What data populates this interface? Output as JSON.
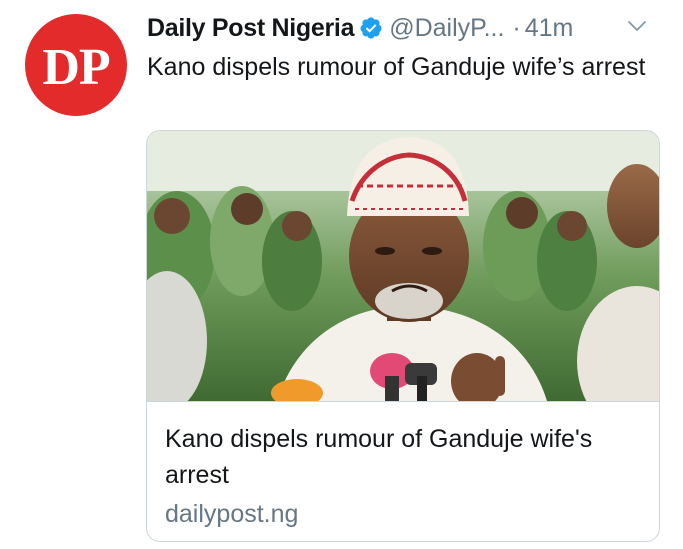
{
  "tweet": {
    "author": {
      "avatar_text": "DP",
      "display_name": "Daily Post Nigeria",
      "handle": "@DailyP...",
      "verified_icon": "verified-badge-icon"
    },
    "separator": "·",
    "time": "41m",
    "menu_icon": "chevron-down-icon",
    "text": "Kano dispels rumour of Ganduje wife’s arrest",
    "card": {
      "title": "Kano dispels rumour of Ganduje wife's arrest",
      "domain": "dailypost.ng"
    }
  },
  "colors": {
    "avatar_red": "#e32b2b",
    "verified_blue": "#1da1f2",
    "secondary_text": "#657786",
    "border": "#ccd6dd"
  }
}
